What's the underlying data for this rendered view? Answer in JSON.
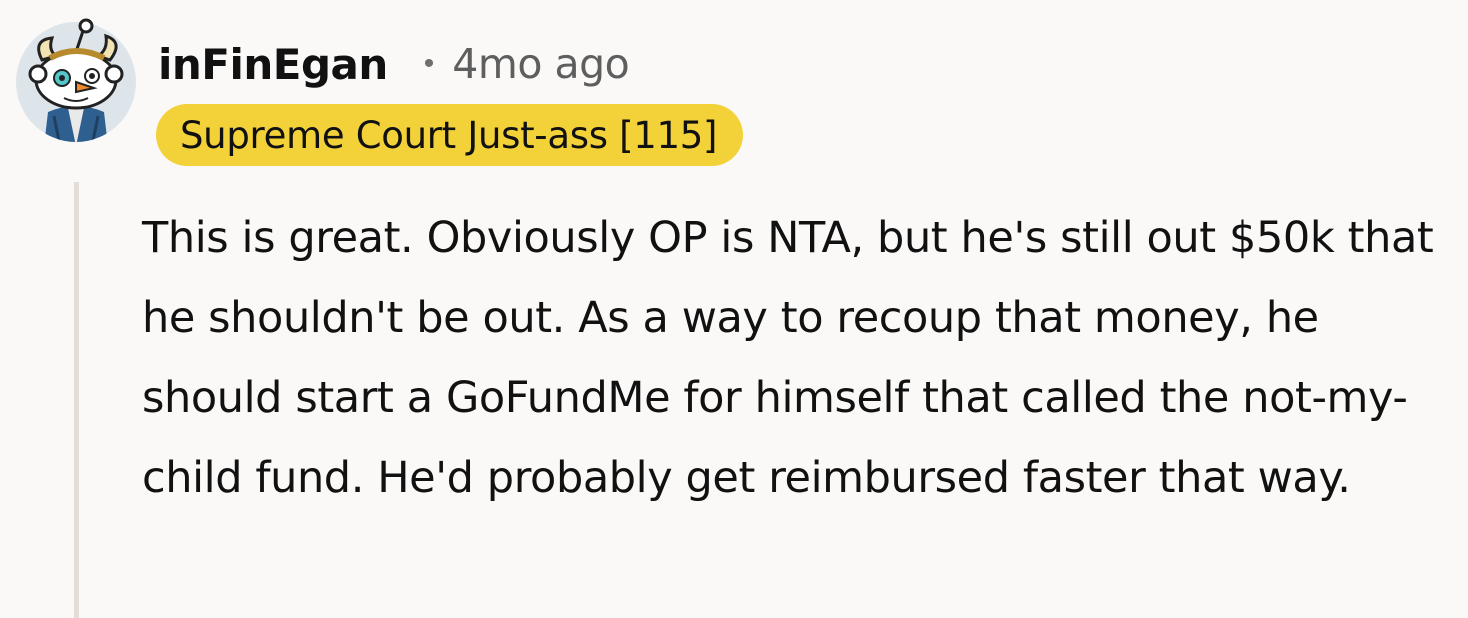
{
  "comment": {
    "author": "inFinEgan",
    "separator": "•",
    "time_ago": "4mo ago",
    "flair": "Supreme Court Just-ass [115]",
    "body": "This is great. Obviously OP is NTA, but he's still out $50k that he shouldn't be out. As a way to recoup that money, he should start a GoFundMe for himself that called the not-my-child fund. He'd probably get reimbursed faster that way."
  },
  "avatar": {
    "icon": "snoo-avatar-icon"
  },
  "colors": {
    "background": "#faf9f8",
    "flair_background": "#f3d239",
    "thread_line": "#e4dcd6",
    "text": "#111111",
    "muted_text": "#5e5e5e"
  }
}
